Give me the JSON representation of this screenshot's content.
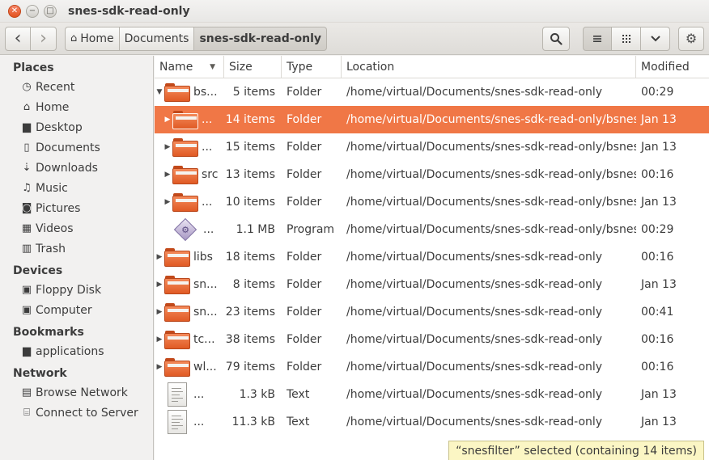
{
  "window": {
    "title": "snes-sdk-read-only"
  },
  "toolbar": {
    "back_icon": "‹",
    "forward_icon": "›",
    "breadcrumbs": [
      "Home",
      "Documents",
      "snes-sdk-read-only"
    ]
  },
  "sidebar": {
    "places_title": "Places",
    "places": [
      "Recent",
      "Home",
      "Desktop",
      "Documents",
      "Downloads",
      "Music",
      "Pictures",
      "Videos",
      "Trash"
    ],
    "devices_title": "Devices",
    "devices": [
      "Floppy Disk",
      "Computer"
    ],
    "bookmarks_title": "Bookmarks",
    "bookmarks": [
      "applications"
    ],
    "network_title": "Network",
    "network": [
      "Browse Network",
      "Connect to Server"
    ]
  },
  "columns": {
    "name": "Name",
    "size": "Size",
    "type": "Type",
    "location": "Location",
    "modified": "Modified"
  },
  "rows": [
    {
      "name": "bs...",
      "size": "5 items",
      "type": "Folder",
      "location": "/home/virtual/Documents/snes-sdk-read-only",
      "modified": "00:29",
      "icon": "folder",
      "expanded": true,
      "selected": false,
      "indent": 0
    },
    {
      "name": "...",
      "size": "14 items",
      "type": "Folder",
      "location": "/home/virtual/Documents/snes-sdk-read-only/bsnes",
      "modified": "Jan 13",
      "icon": "folder",
      "expanded": false,
      "selected": true,
      "indent": 1
    },
    {
      "name": "...",
      "size": "15 items",
      "type": "Folder",
      "location": "/home/virtual/Documents/snes-sdk-read-only/bsnes",
      "modified": "Jan 13",
      "icon": "folder",
      "expanded": false,
      "selected": false,
      "indent": 1
    },
    {
      "name": "src",
      "size": "13 items",
      "type": "Folder",
      "location": "/home/virtual/Documents/snes-sdk-read-only/bsnes",
      "modified": "00:16",
      "icon": "folder",
      "expanded": false,
      "selected": false,
      "indent": 1
    },
    {
      "name": "...",
      "size": "10 items",
      "type": "Folder",
      "location": "/home/virtual/Documents/snes-sdk-read-only/bsnes",
      "modified": "Jan 13",
      "icon": "folder",
      "expanded": false,
      "selected": false,
      "indent": 1
    },
    {
      "name": "...",
      "size": "1.1 MB",
      "type": "Program",
      "location": "/home/virtual/Documents/snes-sdk-read-only/bsnes",
      "modified": "00:29",
      "icon": "program",
      "expanded": null,
      "selected": false,
      "indent": 1
    },
    {
      "name": "libs",
      "size": "18 items",
      "type": "Folder",
      "location": "/home/virtual/Documents/snes-sdk-read-only",
      "modified": "00:16",
      "icon": "folder",
      "expanded": false,
      "selected": false,
      "indent": 0
    },
    {
      "name": "sn...",
      "size": "8 items",
      "type": "Folder",
      "location": "/home/virtual/Documents/snes-sdk-read-only",
      "modified": "Jan 13",
      "icon": "folder",
      "expanded": false,
      "selected": false,
      "indent": 0
    },
    {
      "name": "sn...",
      "size": "23 items",
      "type": "Folder",
      "location": "/home/virtual/Documents/snes-sdk-read-only",
      "modified": "00:41",
      "icon": "folder",
      "expanded": false,
      "selected": false,
      "indent": 0
    },
    {
      "name": "tc...",
      "size": "38 items",
      "type": "Folder",
      "location": "/home/virtual/Documents/snes-sdk-read-only",
      "modified": "00:16",
      "icon": "folder",
      "expanded": false,
      "selected": false,
      "indent": 0
    },
    {
      "name": "wl...",
      "size": "79 items",
      "type": "Folder",
      "location": "/home/virtual/Documents/snes-sdk-read-only",
      "modified": "00:16",
      "icon": "folder",
      "expanded": false,
      "selected": false,
      "indent": 0
    },
    {
      "name": "...",
      "size": "1.3 kB",
      "type": "Text",
      "location": "/home/virtual/Documents/snes-sdk-read-only",
      "modified": "Jan 13",
      "icon": "text",
      "expanded": null,
      "selected": false,
      "indent": 0
    },
    {
      "name": "...",
      "size": "11.3 kB",
      "type": "Text",
      "location": "/home/virtual/Documents/snes-sdk-read-only",
      "modified": "Jan 13",
      "icon": "text",
      "expanded": null,
      "selected": false,
      "indent": 0
    }
  ],
  "status": {
    "text": "“snesfilter” selected  (containing 14 items)"
  },
  "colors": {
    "accent": "#f07746",
    "folder": "#e8642c",
    "status_bg": "#fbf6c4"
  }
}
